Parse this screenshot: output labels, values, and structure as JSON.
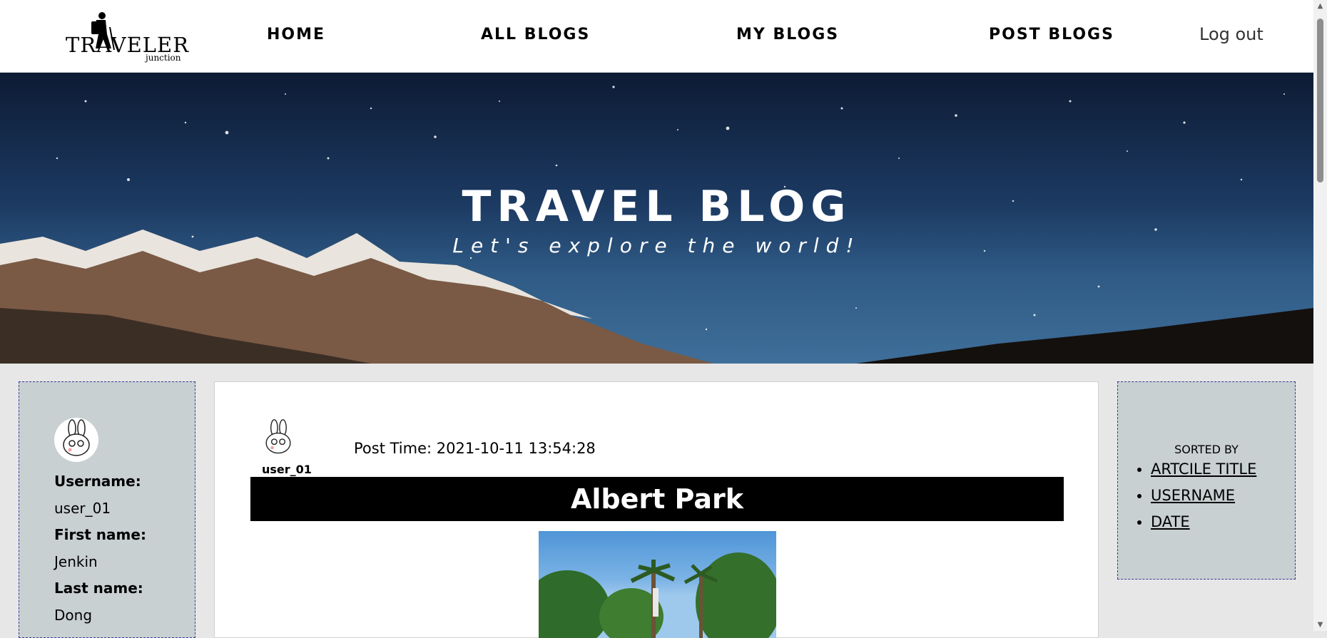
{
  "brand": {
    "logo_text": "TRAVELER",
    "logo_subtext": "junction"
  },
  "nav": {
    "home": "HOME",
    "all_blogs": "ALL BLOGS",
    "my_blogs": "MY BLOGS",
    "post_blogs": "POST BLOGS",
    "logout": "Log out"
  },
  "hero": {
    "title": "TRAVEL BLOG",
    "subtitle": "Let's explore the world!"
  },
  "profile": {
    "avatar_icon": "bunny-avatar-icon",
    "username_label": "Username:",
    "username": "user_01",
    "first_name_label": "First name:",
    "first_name": "Jenkin",
    "last_name_label": "Last name:",
    "last_name": "Dong"
  },
  "post": {
    "author": "user_01",
    "post_time": "Post Time: 2021-10-11 13:54:28",
    "title": "Albert Park"
  },
  "sort": {
    "heading": "SORTED BY",
    "options": [
      "ARTCILE TITLE",
      "USERNAME",
      "DATE"
    ]
  },
  "colors": {
    "panel_bg": "#c9d0d2",
    "panel_border": "#3a3a9a",
    "title_bar": "#000000",
    "page_bg": "#e7e7e7"
  }
}
